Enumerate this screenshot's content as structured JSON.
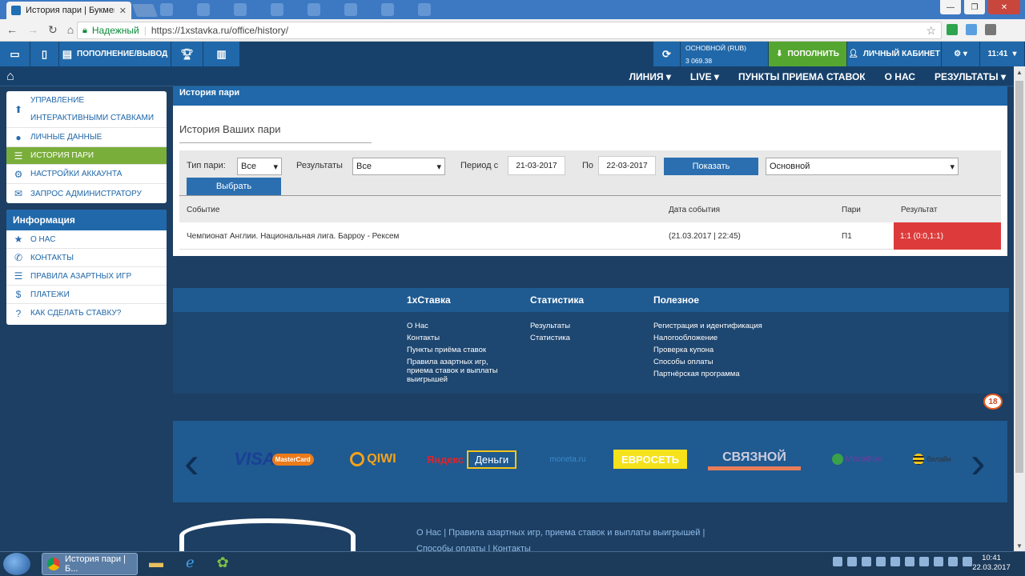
{
  "browser": {
    "tab_title": "История пари | Букмек",
    "tab_close": "✕",
    "secure_label": "Надежный",
    "url": "https://1xstavka.ru/office/history/",
    "window_buttons": [
      "—",
      "❐",
      "✕"
    ]
  },
  "topbar": {
    "deposit_withdraw": "ПОПОЛНЕНИЕ/ВЫВОД",
    "balance_label": "ОСНОВНОЙ (RUB)",
    "balance_value": "3 069.38",
    "deposit_btn": "ПОПОЛНИТЬ",
    "cabinet_btn": "ЛИЧНЫЙ КАБИНЕТ",
    "time": "11:41"
  },
  "menu": {
    "items": [
      "ЛИНИЯ",
      "LIVE",
      "ПУНКТЫ ПРИЕМА СТАВОК",
      "О НАС",
      "РЕЗУЛЬТАТЫ"
    ]
  },
  "sidebar": {
    "account_items": [
      {
        "label": "УПРАВЛЕНИЕ ИНТЕРАКТИВНЫМИ СТАВКАМИ",
        "icon": "upload-icon"
      },
      {
        "label": "ЛИЧНЫЕ ДАННЫЕ",
        "icon": "user-icon"
      },
      {
        "label": "ИСТОРИЯ ПАРИ",
        "icon": "list-icon"
      },
      {
        "label": "НАСТРОЙКИ АККАУНТА",
        "icon": "settings-icon"
      },
      {
        "label": "ЗАПРОС АДМИНИСТРАТОРУ",
        "icon": "mail-icon"
      }
    ],
    "info_title": "Информация",
    "info_items": [
      {
        "label": "О НАС",
        "icon": "star-icon"
      },
      {
        "label": "КОНТАКТЫ",
        "icon": "phone-icon"
      },
      {
        "label": "ПРАВИЛА АЗАРТНЫХ ИГР",
        "icon": "rules-icon"
      },
      {
        "label": "ПЛАТЕЖИ",
        "icon": "dollar-icon"
      },
      {
        "label": "КАК СДЕЛАТЬ СТАВКУ?",
        "icon": "help-icon"
      }
    ]
  },
  "main": {
    "header": "История пари",
    "title": "История Ваших пари",
    "filters": {
      "bet_type_label": "Тип пари:",
      "bet_type_value": "Все",
      "results_label": "Результаты",
      "results_value": "Все",
      "period_from_label": "Период с",
      "period_from": "21-03-2017",
      "period_to_label": "По",
      "period_to": "22-03-2017",
      "show_btn": "Показать",
      "account_value": "Основной",
      "select_btn": "Выбрать"
    },
    "table": {
      "columns": [
        "Событие",
        "Дата события",
        "Пари",
        "Результат"
      ],
      "rows": [
        {
          "event": "Чемпионат Англии. Национальная лига. Барроу - Рексем",
          "date": "(21.03.2017 | 22:45)",
          "bet": "П1",
          "result": "1:1 (0:0,1:1)"
        }
      ]
    }
  },
  "footer": {
    "cols": [
      {
        "title": "1xСтавка",
        "links": [
          "О Нас",
          "Контакты",
          "Пункты приёма ставок",
          "Правила азартных игр, приема ставок и выплаты выигрышей"
        ]
      },
      {
        "title": "Статистика",
        "links": [
          "Результаты",
          "Статистика"
        ]
      },
      {
        "title": "Полезное",
        "links": [
          "Регистрация и идентификация",
          "Налогообложение",
          "Проверка купона",
          "Способы оплаты",
          "Партнёрская программа"
        ]
      }
    ],
    "age_badge": "18",
    "payments": [
      "VISA",
      "MasterCard",
      "QIWI",
      "Яндекс",
      "Деньги",
      "moneta.ru",
      "ЕВРОСЕТЬ",
      "СВЯЗНОЙ",
      "МегаФон",
      "билайн"
    ],
    "bottom_links": [
      "О Нас",
      "Правила азартных игр, приема ставок и выплаты выигрышей",
      "Способы оплаты",
      "Контакты"
    ]
  },
  "taskbar": {
    "chrome_label": "История пари | Б...",
    "time": "10:41",
    "date": "22.03.2017"
  }
}
